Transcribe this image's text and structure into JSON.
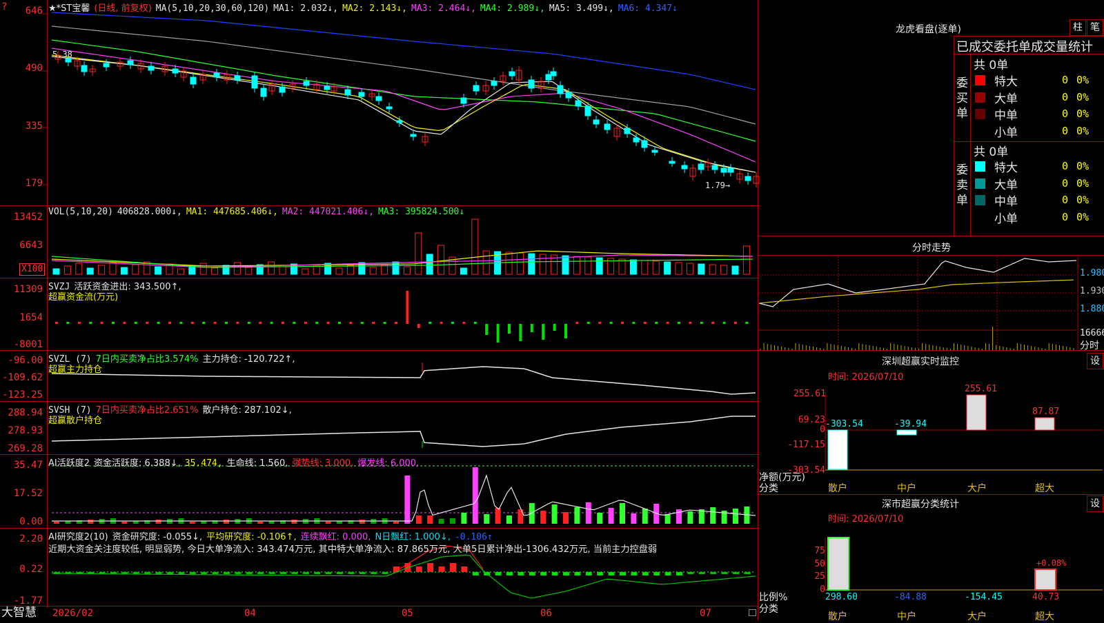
{
  "colors": {
    "bg": "#000000",
    "grid": "#aa0000",
    "up": "#ff2020",
    "down": "#00ffff",
    "ma_white": "#e6e6e6",
    "ma_yellow": "#f0f000",
    "ma_magenta": "#ff40ff",
    "ma_green": "#30ff30",
    "ma_gray": "#a0a0a0",
    "ma_blue": "#2040ff"
  },
  "app": {
    "logo": "大智慧",
    "menu_glyph": "?"
  },
  "price_panel": {
    "title": "★*ST宝馨",
    "period": "(日线, 前复权)",
    "ma_label": "MA(5,10,20,30,60,120)",
    "ma1": "MA1: 2.032↓,",
    "ma2": "MA2: 2.143↓,",
    "ma3": "MA3: 2.464↓,",
    "ma4": "MA4: 2.989↓,",
    "ma5": "MA5: 3.499↓,",
    "ma6": "MA6: 4.347↓",
    "y_ticks": [
      "646",
      "490",
      "335",
      "179"
    ],
    "high_marker": "5.38",
    "low_marker": "1.79→"
  },
  "vol_panel": {
    "title": "VOL(5,10,20)",
    "value": "406828.000↓,",
    "ma1": "MA1: 447685.406↓,",
    "ma2": "MA2: 447021.406↓,",
    "ma3": "MA3: 395824.500↓",
    "y_ticks": [
      "13452",
      "6643"
    ],
    "unit": "X100"
  },
  "svzj_panel": {
    "title": "SVZJ",
    "label": "活跃资金进出: 343.500↑,",
    "sub": "超赢资金流(万元)",
    "y_ticks": [
      "11309",
      "1654",
      "-8001"
    ]
  },
  "svzl_panel": {
    "title": "SVZL (7)",
    "ratio": "7日内买卖净占比3.574%",
    "label": "主力持仓: -120.722↑,",
    "sub": "超赢主力持仓",
    "y_ticks": [
      "-96.00",
      "-109.62",
      "-123.25"
    ]
  },
  "svsh_panel": {
    "title": "SVSH (7)",
    "ratio": "7日内买卖净占比2.651%",
    "label": "散户持仓: 287.102↓,",
    "sub": "超赢散户持仓",
    "y_ticks": [
      "288.94",
      "278.93",
      "269.28"
    ]
  },
  "ai_active_panel": {
    "title": "AI活跃度2",
    "label": "资金活跃度: 6.388↓,",
    "v2": "35.474,",
    "v3": "生命线: 1.560,",
    "v4": "强势线: 3.000,",
    "v5": "爆发线: 6.000,",
    "y_ticks": [
      "35.47",
      "17.52",
      "0.00"
    ]
  },
  "ai_research_panel": {
    "title": "AI研究度2(10)",
    "label": "资金研究度: -0.055↓,",
    "avg": "平均研究度: -0.106↑,",
    "lianxu": "连续飘红: 0.000,",
    "nri": "N日飘红: 1.000↓,",
    "last": "-0.106↑",
    "comment": "近期大资金关注度较低, 明显弱势, 今日大单净流入: 343.474万元, 其中特大单净流入: 87.865万元, 大单5日累计净出-1306.432万元, 当前主力控盘弱",
    "y_ticks": [
      "2.20",
      "0.22",
      "-1.77"
    ]
  },
  "x_axis": {
    "labels": [
      "2026/02",
      "04",
      "05",
      "06",
      "07"
    ]
  },
  "right_panel": {
    "lhb_title": "龙虎看盘(逐单)",
    "btn_column": "柱",
    "btn_stroke": "笔",
    "stats_title": "已成交委托单成交量统计",
    "buy": {
      "side": "委买单",
      "total": "共 0单",
      "rows": [
        {
          "name": "特大",
          "count": "0",
          "pct": "0%",
          "color": "#ff0000"
        },
        {
          "name": "大单",
          "count": "0",
          "pct": "0%",
          "color": "#990000"
        },
        {
          "name": "中单",
          "count": "0",
          "pct": "0%",
          "color": "#660000"
        },
        {
          "name": "小单",
          "count": "0",
          "pct": "0%",
          "color": ""
        }
      ]
    },
    "sell": {
      "side": "委卖单",
      "total": "共 0单",
      "rows": [
        {
          "name": "特大",
          "count": "0",
          "pct": "0%",
          "color": "#00ffff"
        },
        {
          "name": "大单",
          "count": "0",
          "pct": "0%",
          "color": "#009999"
        },
        {
          "name": "中单",
          "count": "0",
          "pct": "0%",
          "color": "#006666"
        },
        {
          "name": "小单",
          "count": "0",
          "pct": "0%",
          "color": ""
        }
      ]
    },
    "intraday": {
      "title": "分时走势",
      "y_ticks": [
        "1.980",
        "1.930",
        "1.880"
      ],
      "vol_tick": "16666",
      "unit": "分时"
    },
    "sz_monitor": {
      "title": "深圳超赢实时监控",
      "setting": "设",
      "time": "时间: 2026/07/10",
      "y_ticks": [
        "255.61",
        "69.23",
        "0",
        "-117.15",
        "-303.54"
      ],
      "y_label": "净额(万元)",
      "x_label": "分类",
      "categories": [
        "散户",
        "中户",
        "大户",
        "超大"
      ],
      "values": [
        "-303.54",
        "-39.94",
        "255.61",
        "87.87"
      ]
    },
    "sz_class": {
      "title": "深市超赢分类统计",
      "setting": "设",
      "time": "时间: 2026/07/10",
      "y_ticks": [
        "75",
        "50",
        "25",
        "0"
      ],
      "y_label": "比例%",
      "x_label": "分类",
      "categories": [
        "散户",
        "中户",
        "大户",
        "超大"
      ],
      "values": [
        "298.60",
        "-84.88",
        "-154.45",
        "40.73"
      ],
      "pct_label": "+0.08%"
    }
  }
}
